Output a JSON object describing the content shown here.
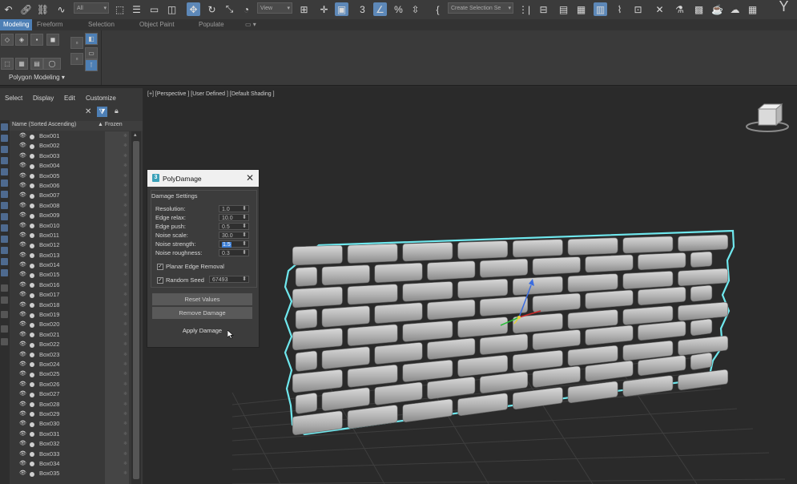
{
  "toolbar": {
    "filter_value": "All",
    "view_value": "View",
    "selection_set_placeholder": "Create Selection Se"
  },
  "ribbon": {
    "tabs": [
      "Modeling",
      "Freeform",
      "Selection",
      "Object Paint",
      "Populate"
    ],
    "panel_label": "Polygon Modeling ▾"
  },
  "explorer": {
    "menu": [
      "Select",
      "Display",
      "Edit",
      "Customize"
    ],
    "column_name": "Name (Sorted Ascending)",
    "column_frozen": "▲ Frozen",
    "items": [
      "Box001",
      "Box002",
      "Box003",
      "Box004",
      "Box005",
      "Box006",
      "Box007",
      "Box008",
      "Box009",
      "Box010",
      "Box011",
      "Box012",
      "Box013",
      "Box014",
      "Box015",
      "Box016",
      "Box017",
      "Box018",
      "Box019",
      "Box020",
      "Box021",
      "Box022",
      "Box023",
      "Box024",
      "Box025",
      "Box026",
      "Box027",
      "Box028",
      "Box029",
      "Box030",
      "Box031",
      "Box032",
      "Box033",
      "Box034",
      "Box035"
    ]
  },
  "viewport": {
    "label": "[+] [Perspective ] [User Defined ] [Default Shading ]"
  },
  "dialog": {
    "title": "PolyDamage",
    "logo": "3",
    "group_label": "Damage Settings",
    "params": [
      {
        "label": "Resolution:",
        "value": "1.0"
      },
      {
        "label": "Edge relax:",
        "value": "10.0"
      },
      {
        "label": "Edge push:",
        "value": "0.5"
      },
      {
        "label": "Noise scale:",
        "value": "30.0"
      },
      {
        "label": "Noise strength:",
        "value": "1.5"
      },
      {
        "label": "Noise roughness:",
        "value": "0.3"
      }
    ],
    "planar_edge_removal": {
      "label": "Planar Edge Removal",
      "checked": true
    },
    "random_seed": {
      "label": "Random Seed",
      "checked": true,
      "value": "67493"
    },
    "buttons": {
      "reset": "Reset Values",
      "remove": "Remove Damage",
      "apply": "Apply Damage"
    }
  },
  "colors": {
    "accent": "#4d7fb5",
    "selection_outline": "#6fe8ee",
    "brick": "#b9b9b9"
  }
}
